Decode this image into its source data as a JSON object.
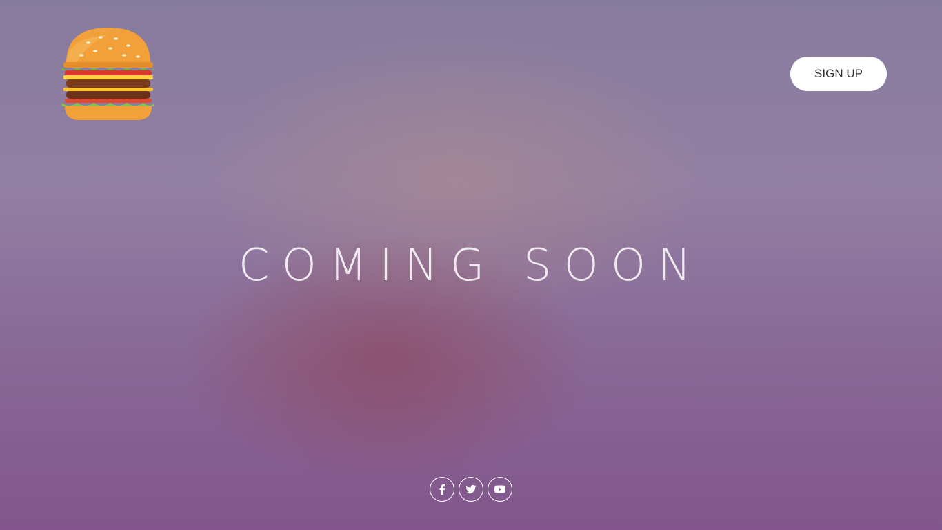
{
  "header": {
    "logo_icon": "burger-icon",
    "signup_label": "SIGN UP"
  },
  "hero": {
    "headline": "COMING SOON",
    "background_description_icon": "burger-photo"
  },
  "social": {
    "items": [
      {
        "icon": "facebook-icon"
      },
      {
        "icon": "twitter-icon"
      },
      {
        "icon": "youtube-icon"
      }
    ]
  },
  "colors": {
    "overlay": "#7d6b8e",
    "button_bg": "#ffffff",
    "headline": "#ffffff"
  }
}
